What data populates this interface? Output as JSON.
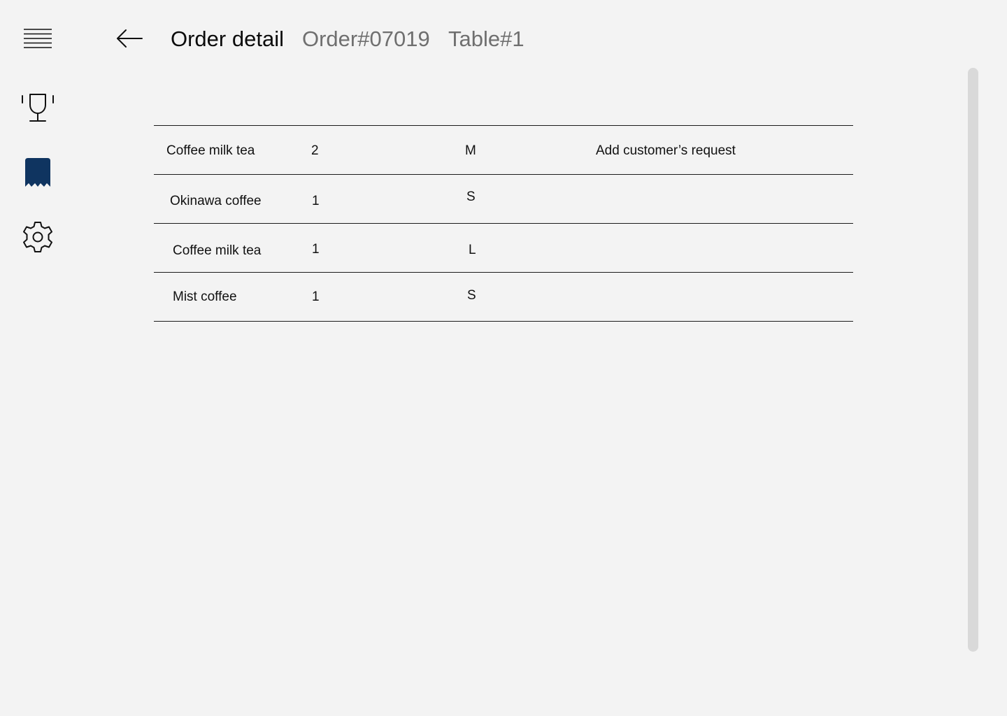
{
  "sidebar": {
    "items": [
      {
        "icon": "menu-icon"
      },
      {
        "icon": "trophy-icon"
      },
      {
        "icon": "receipt-icon",
        "active": true
      },
      {
        "icon": "gear-icon"
      }
    ],
    "active_color": "#0f3460"
  },
  "header": {
    "back_icon": "arrow-left-icon",
    "title": "Order detail",
    "order_number": "Order#07019",
    "table_number": "Table#1"
  },
  "order": {
    "items": [
      {
        "name": "Coffee milk tea",
        "qty": "2",
        "size": "M",
        "request": "Add customer’s request"
      },
      {
        "name": "Okinawa coffee",
        "qty": "1",
        "size": "S",
        "request": ""
      },
      {
        "name": "Coffee milk tea",
        "qty": "1",
        "size": "L",
        "request": ""
      },
      {
        "name": "Mist coffee",
        "qty": "1",
        "size": "S",
        "request": ""
      }
    ]
  }
}
